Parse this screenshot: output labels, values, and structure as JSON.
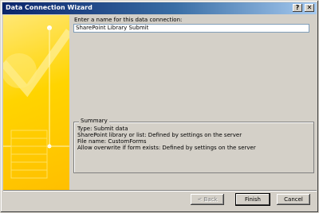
{
  "window": {
    "title": "Data Connection Wizard",
    "help_label": "?",
    "close_label": "✕"
  },
  "form": {
    "name_label": "Enter a name for this data connection:",
    "name_value": "SharePoint Library Submit"
  },
  "summary": {
    "legend": "Summary",
    "lines": [
      "Type: Submit data",
      "SharePoint library or list: Defined by settings on the server",
      "File name: CustomForms",
      "Allow overwrite if form exists: Defined by settings on the server"
    ]
  },
  "buttons": {
    "back": "< Back",
    "finish": "Finish",
    "cancel": "Cancel"
  }
}
